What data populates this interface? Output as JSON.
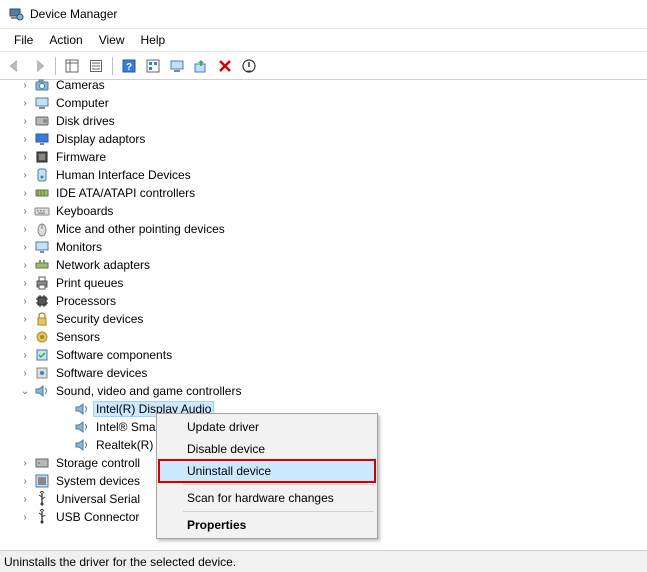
{
  "window": {
    "title": "Device Manager"
  },
  "menu": {
    "file": "File",
    "action": "Action",
    "view": "View",
    "help": "Help"
  },
  "tree": {
    "items": [
      {
        "label": "Cameras"
      },
      {
        "label": "Computer"
      },
      {
        "label": "Disk drives"
      },
      {
        "label": "Display adaptors"
      },
      {
        "label": "Firmware"
      },
      {
        "label": "Human Interface Devices"
      },
      {
        "label": "IDE ATA/ATAPI controllers"
      },
      {
        "label": "Keyboards"
      },
      {
        "label": "Mice and other pointing devices"
      },
      {
        "label": "Monitors"
      },
      {
        "label": "Network adapters"
      },
      {
        "label": "Print queues"
      },
      {
        "label": "Processors"
      },
      {
        "label": "Security devices"
      },
      {
        "label": "Sensors"
      },
      {
        "label": "Software components"
      },
      {
        "label": "Software devices"
      }
    ],
    "expanded": {
      "label": "Sound, video and game controllers",
      "children": [
        {
          "label": "Intel(R) Display Audio"
        },
        {
          "label": "Intel® Smar"
        },
        {
          "label": "Realtek(R) A"
        }
      ]
    },
    "after": [
      {
        "label": "Storage controll"
      },
      {
        "label": "System devices"
      },
      {
        "label": "Universal Serial"
      },
      {
        "label": "USB Connector"
      }
    ]
  },
  "context": {
    "update": "Update driver",
    "disable": "Disable device",
    "uninstall": "Uninstall device",
    "scan": "Scan for hardware changes",
    "properties": "Properties"
  },
  "status": {
    "text": "Uninstalls the driver for the selected device."
  }
}
